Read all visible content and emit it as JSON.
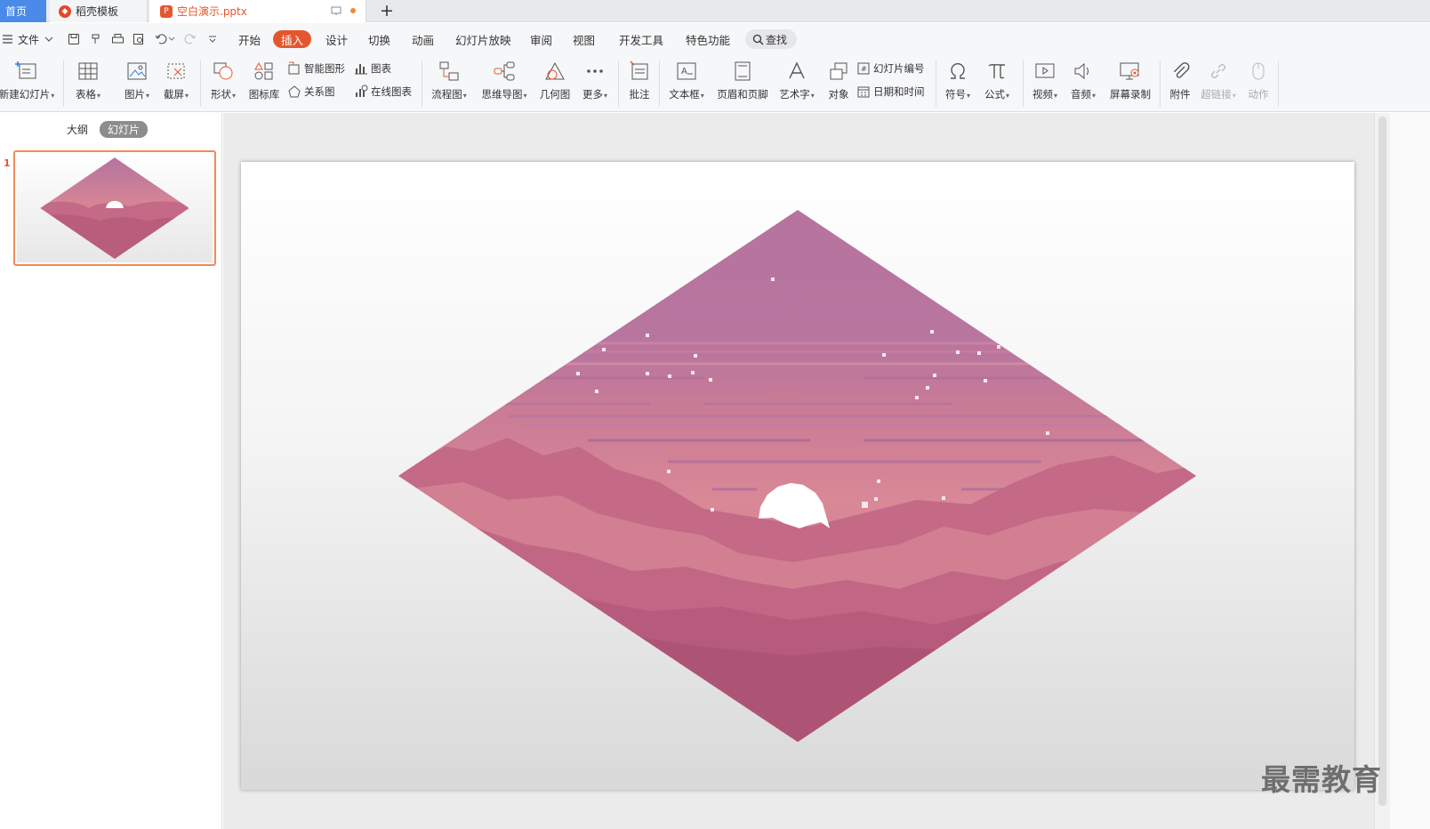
{
  "tabs": {
    "home": "首页",
    "template": "稻壳模板",
    "document": "空白演示.pptx",
    "new_tab": "+"
  },
  "menu": {
    "file": "文件",
    "tabs": [
      "开始",
      "插入",
      "设计",
      "切换",
      "动画",
      "幻灯片放映",
      "审阅",
      "视图",
      "开发工具",
      "特色功能"
    ],
    "active_tab": "插入",
    "search": "查找"
  },
  "ribbon": {
    "new_slide": "新建幻灯片",
    "table": "表格",
    "picture": "图片",
    "screenshot": "截屏",
    "shape": "形状",
    "icon_library": "图标库",
    "smart_shape": "智能图形",
    "relation": "关系图",
    "chart": "图表",
    "online_chart": "在线图表",
    "flowchart": "流程图",
    "mindmap": "思维导图",
    "geometry": "几何图",
    "more": "更多",
    "comment": "批注",
    "textbox": "文本框",
    "header_footer": "页眉和页脚",
    "wordart": "艺术字",
    "object": "对象",
    "slide_number": "幻灯片编号",
    "datetime": "日期和时间",
    "symbol": "符号",
    "formula": "公式",
    "video": "视频",
    "audio": "音频",
    "screen_record": "屏幕录制",
    "attachment": "附件",
    "hyperlink": "超链接",
    "action": "动作"
  },
  "left_pane": {
    "outline": "大纲",
    "slides": "幻灯片",
    "slide_number": "1"
  },
  "watermark": "最需教育",
  "colors": {
    "accent": "#e4572e",
    "home_tab": "#4a8ae8",
    "sky_top": "#b5739e",
    "sky_mid": "#d58595",
    "cloud": "#c46a86"
  }
}
